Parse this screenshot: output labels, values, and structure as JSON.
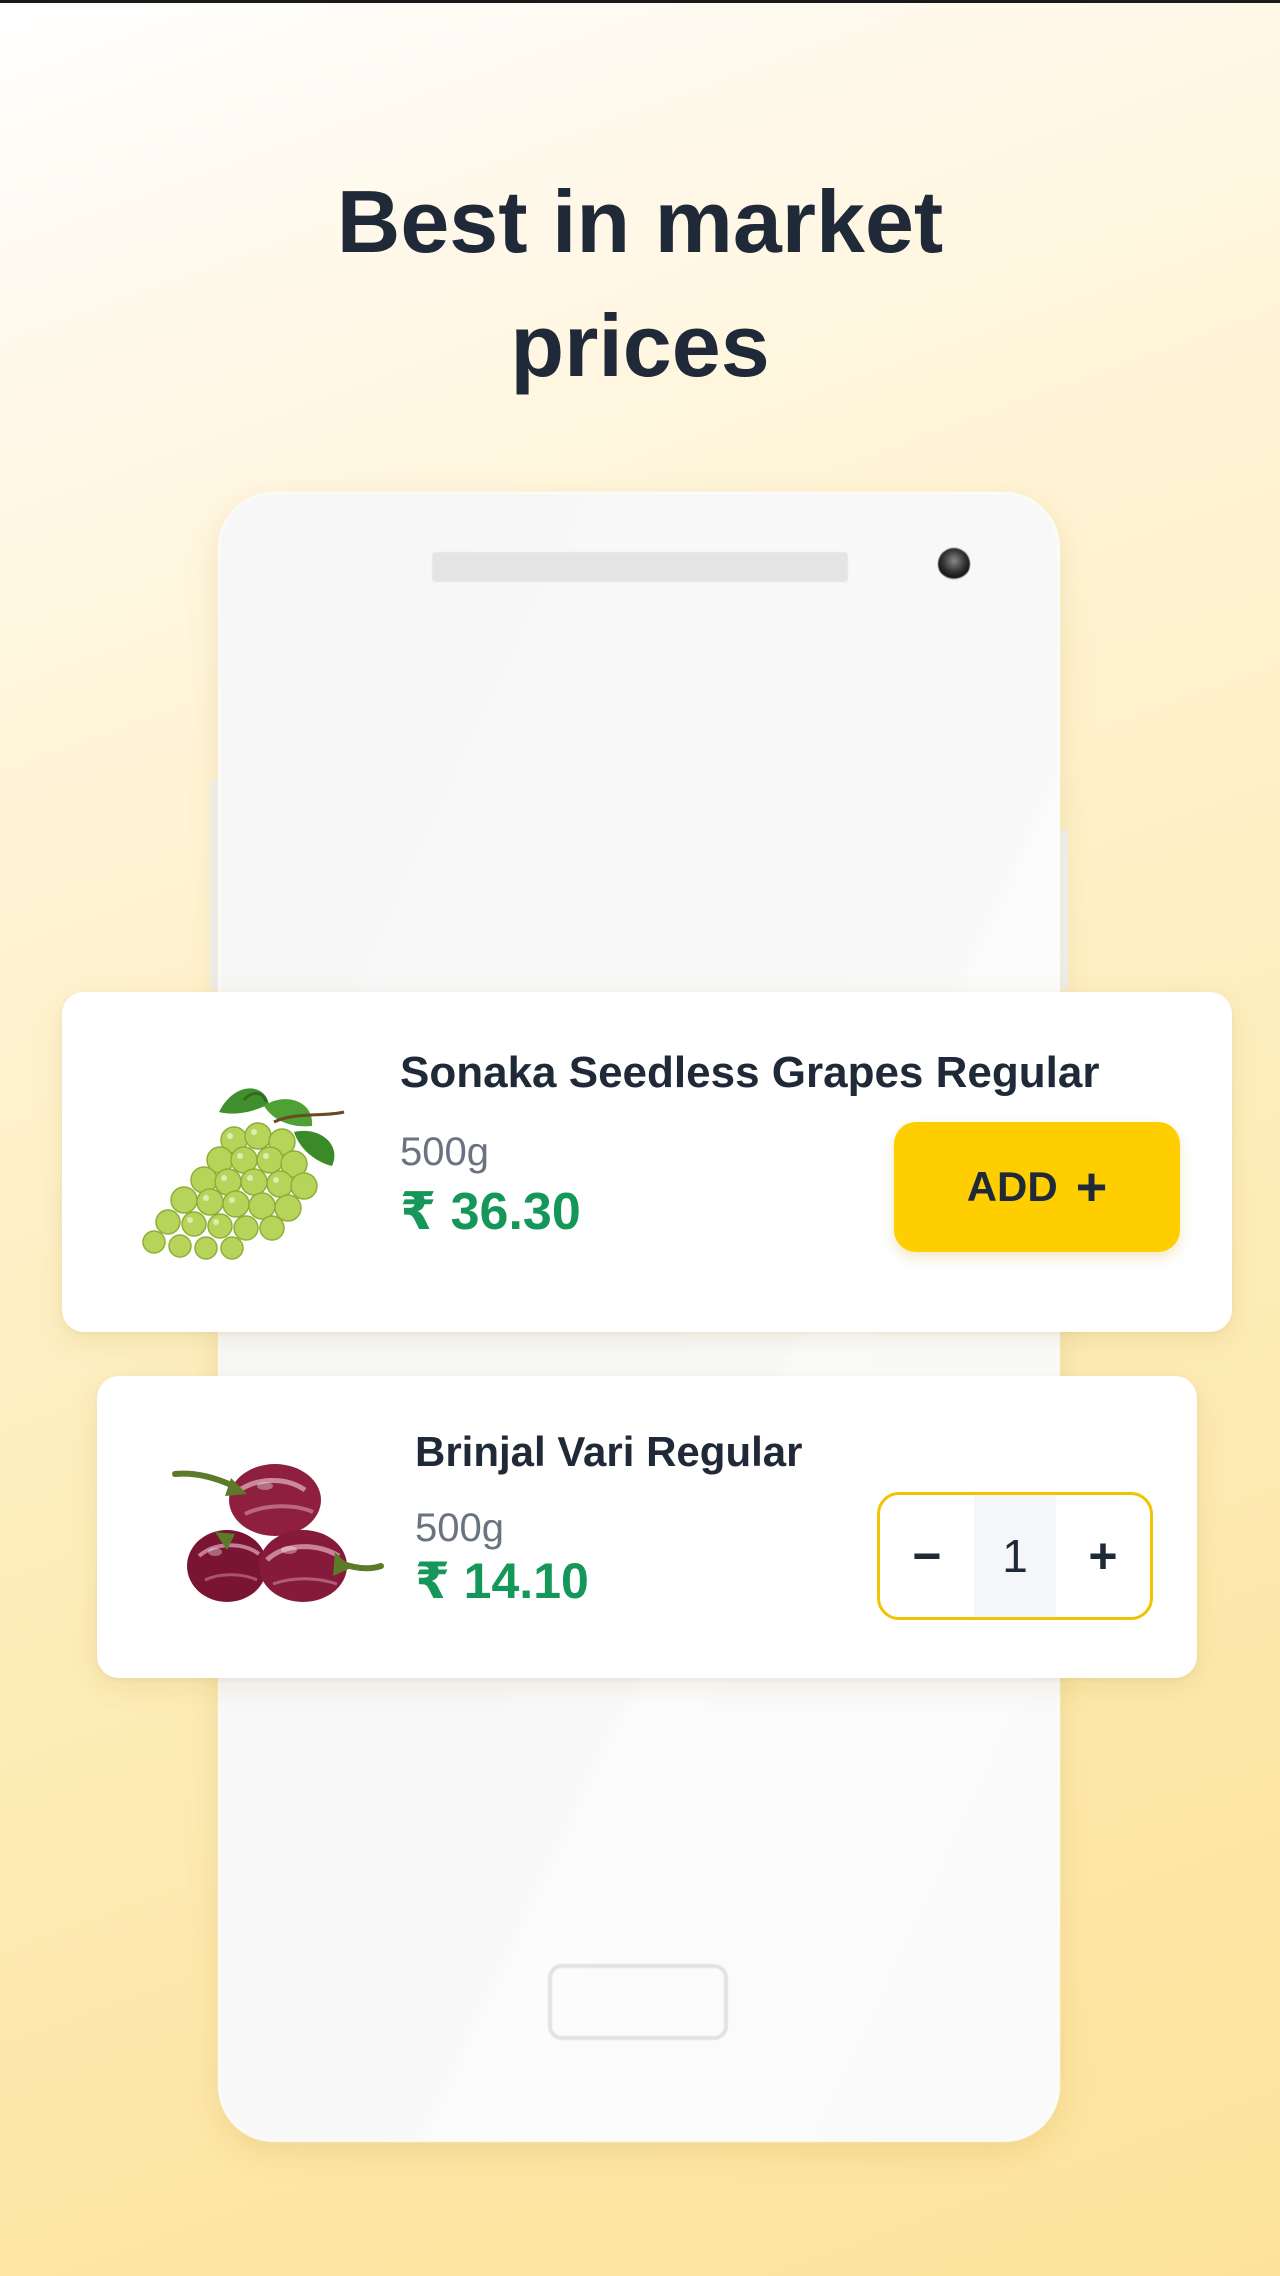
{
  "headline": {
    "line1": "Best in market",
    "line2": "prices"
  },
  "products": [
    {
      "name": "Sonaka Seedless Grapes Regular",
      "weight": "500g",
      "price": "₹ 36.30",
      "image_icon": "grapes-image",
      "action": {
        "label": "ADD",
        "icon": "plus-icon"
      }
    },
    {
      "name": "Brinjal Vari Regular",
      "weight": "500g",
      "price": "₹ 14.10",
      "image_icon": "brinjal-image",
      "quantity": "1",
      "decrement_symbol": "−",
      "increment_symbol": "+"
    }
  ],
  "colors": {
    "accent": "#ffce00",
    "price": "#15975a",
    "text": "#1f2937",
    "muted": "#6b7280"
  }
}
